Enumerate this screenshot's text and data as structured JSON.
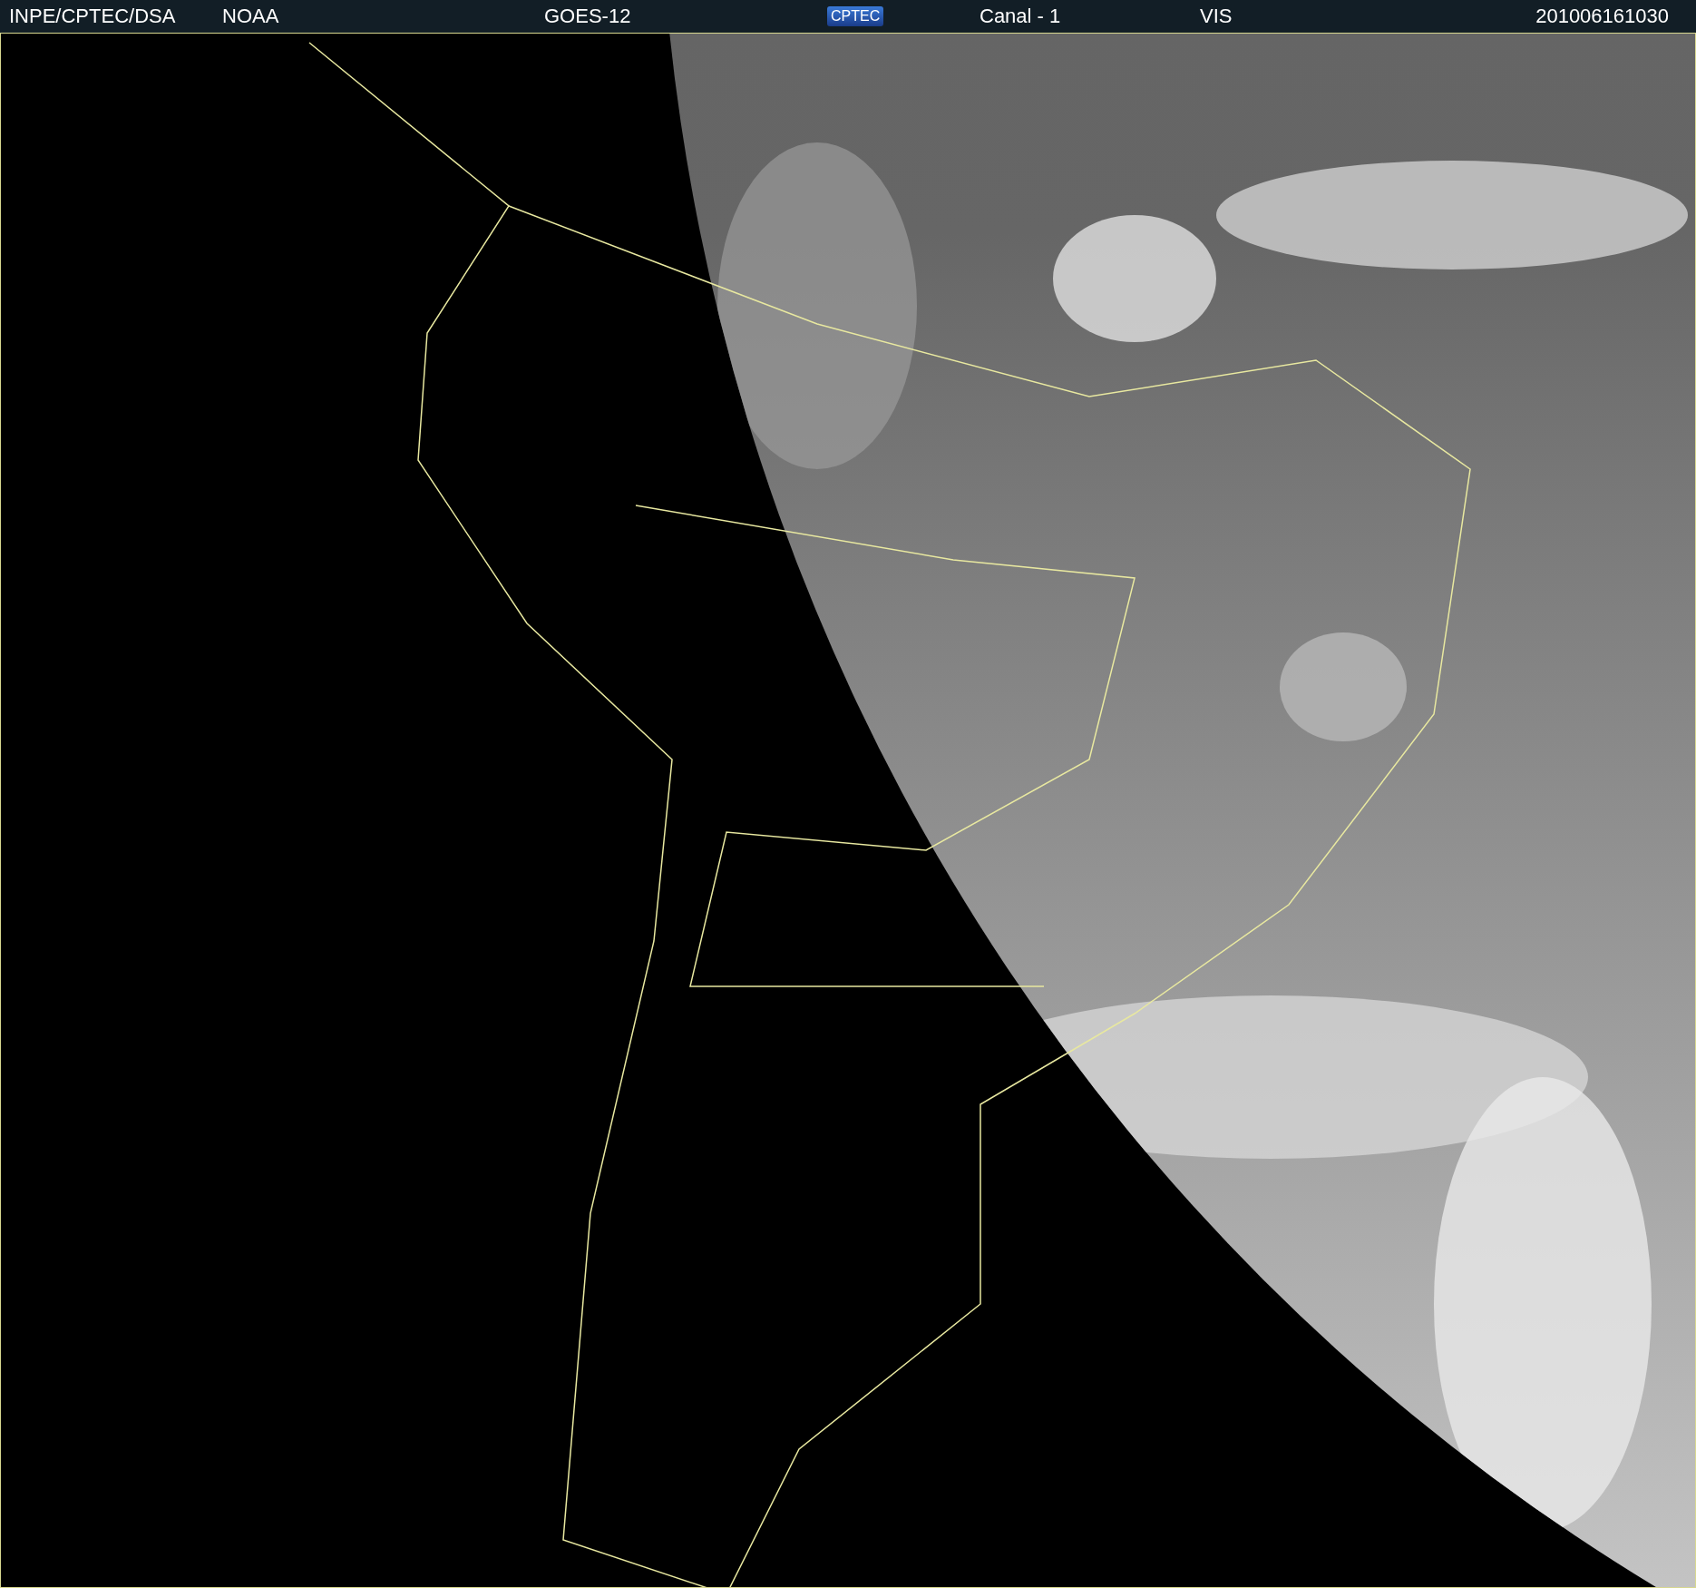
{
  "header": {
    "source": "INPE/CPTEC/DSA",
    "agency": "NOAA",
    "satellite": "GOES-12",
    "logo": "CPTEC",
    "channel": "Canal - 1",
    "band": "VIS",
    "timestamp": "201006161030"
  }
}
